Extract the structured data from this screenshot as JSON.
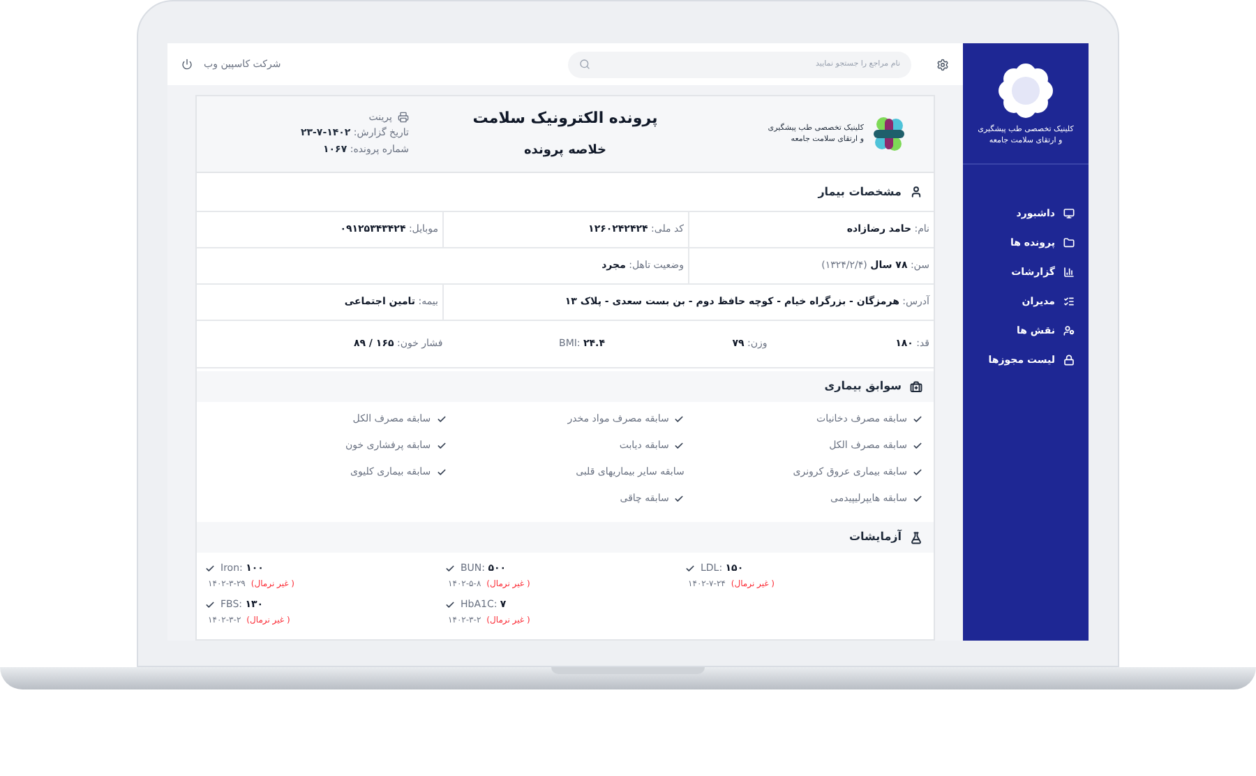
{
  "sidebar": {
    "logo_text": [
      "کلینیک تخصصی طب پیشگیری",
      "و ارتقای سلامت جامعه"
    ],
    "items": [
      {
        "label": "داشبورد"
      },
      {
        "label": "پرونده ها"
      },
      {
        "label": "گزارشات"
      },
      {
        "label": "مدیران"
      },
      {
        "label": "نقش ها"
      },
      {
        "label": "لیست مجوزها"
      }
    ]
  },
  "topbar": {
    "company": "شرکت کاسپین وب",
    "search": {
      "placeholder": "نام مراجع را جستجو نمایید"
    }
  },
  "report": {
    "clinic_name": [
      "کلینیک تخصصی طب پیشگیری",
      "و ارتقای سلامت جامعه"
    ],
    "title": "پرونده الکترونیک سلامت",
    "subtitle": "خلاصه پرونده",
    "print": "پرینت",
    "meta": [
      "تاریخ گزارش: **۱۴۰۲-۷-۲۳**",
      "شماره پرونده: **۱۰۶۷**"
    ]
  },
  "patient": {
    "heading": "مشخصات بیمار",
    "rows": [
      {
        "kind": "cells",
        "fields": [
          "نام: **حامد رضازاده**",
          "کد ملی: **۱۲۶۰۲۴۲۴۲۴**",
          "موبایل: **۰۹۱۲۵۳۴۳۴۲۴**"
        ]
      },
      {
        "kind": "cells",
        "fields": [
          "سن: **۷۸ سال** (۱۳۲۴/۲/۴)",
          "وضعیت تاهل: **مجرد**"
        ]
      },
      {
        "kind": "cells",
        "fields": [
          "آدرس: **هرمزگان - بزرگراه خیام - کوچه حافظ دوم - بن بست سعدی - پلاک ۱۳**",
          "بیمه: **تامین اجتماعی**"
        ]
      },
      {
        "kind": "inline",
        "fields": [
          "قد: **۱۸۰**",
          "وزن: **۷۹**",
          "BMI: **۲۴.۴**",
          "فشار خون: **۱۶۵ / ۸۹**"
        ]
      }
    ]
  },
  "history": {
    "heading": "سوابق بیماری",
    "items": [
      {
        "label": "سابقه مصرف دخانیات",
        "checked": true
      },
      {
        "label": "سابقه مصرف مواد مخدر",
        "checked": true
      },
      {
        "label": "سابقه مصرف الکل",
        "checked": true
      },
      {
        "label": "سابقه مصرف الکل",
        "checked": true
      },
      {
        "label": "سابقه دیابت",
        "checked": true
      },
      {
        "label": "سابقه پرفشاری خون",
        "checked": true
      },
      {
        "label": "سابقه بیماری عروق کرونری",
        "checked": true
      },
      {
        "label": "سابقه سایر بیماریهای قلبی",
        "checked": false
      },
      {
        "label": "سابقه بیماری کلیوی",
        "checked": true
      },
      {
        "label": "سابقه هایپرلیپیدمی",
        "checked": true
      },
      {
        "label": "سابقه چاقی",
        "checked": true
      }
    ]
  },
  "tests": {
    "heading": "آزمایشات",
    "items": [
      {
        "result": "LDL: **۱۵۰**",
        "date": "۱۴۰۲-۷-۲۴",
        "status": "( غیر نرمال)",
        "normal": false,
        "checked": true
      },
      {
        "result": "BUN: **۵۰۰**",
        "date": "۱۴۰۲-۵-۸",
        "status": "( غیر نرمال)",
        "normal": false,
        "checked": true
      },
      {
        "result": "Iron: **۱۰۰**",
        "date": "۱۴۰۲-۳-۲۹",
        "status": "( غیر نرمال)",
        "normal": false,
        "checked": true
      },
      {
        "result": "HbA1C: **۷**",
        "date": "۱۴۰۲-۳-۲",
        "status": "( غیر نرمال)",
        "normal": false,
        "checked": true
      },
      {
        "result": "FBS: **۱۳۰**",
        "date": "۱۴۰۲-۳-۲",
        "status": "( غیر نرمال)",
        "normal": false,
        "checked": true
      }
    ]
  }
}
